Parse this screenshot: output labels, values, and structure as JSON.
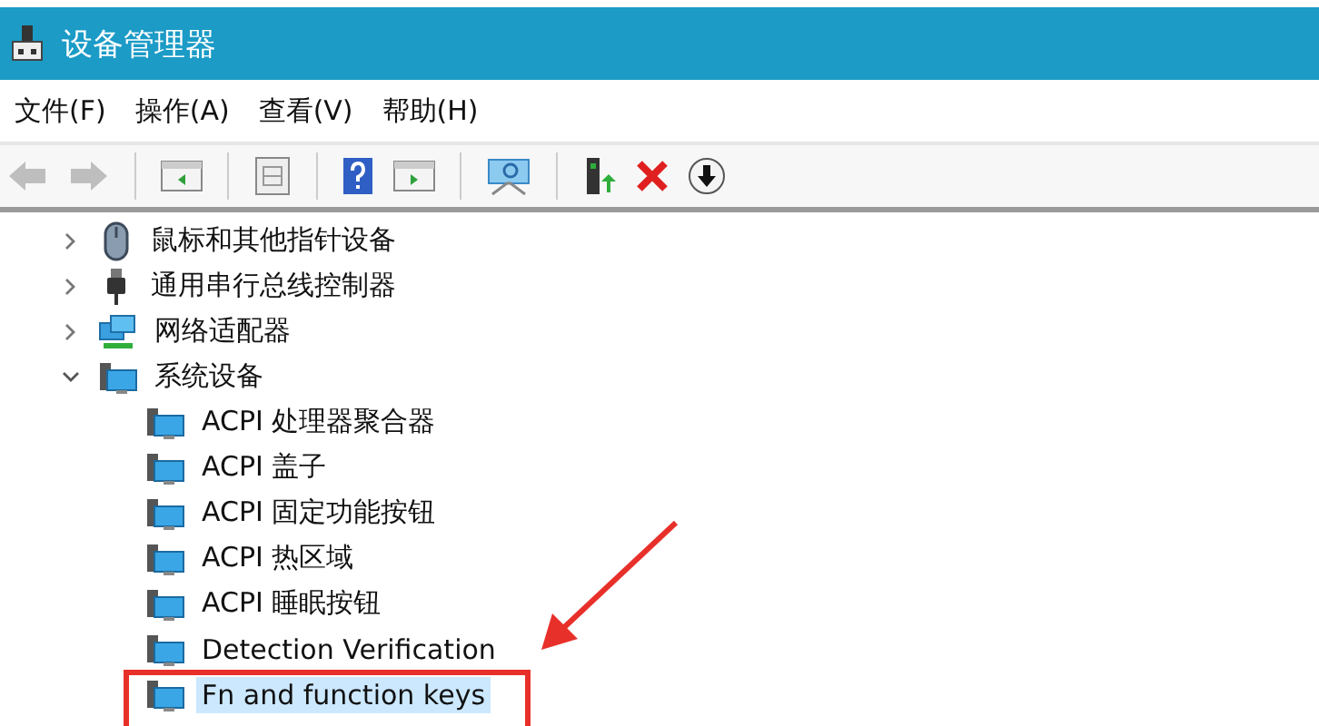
{
  "window": {
    "title": "设备管理器"
  },
  "menu": [
    "文件(F)",
    "操作(A)",
    "查看(V)",
    "帮助(H)"
  ],
  "toolbar": [
    {
      "kind": "back",
      "disabled": true
    },
    {
      "kind": "forward",
      "disabled": true
    },
    {
      "kind": "sep"
    },
    {
      "kind": "panel-left",
      "disabled": false
    },
    {
      "kind": "sep"
    },
    {
      "kind": "properties",
      "disabled": false
    },
    {
      "kind": "sep"
    },
    {
      "kind": "help",
      "disabled": false
    },
    {
      "kind": "panel-right",
      "disabled": false
    },
    {
      "kind": "sep"
    },
    {
      "kind": "monitor",
      "disabled": false
    },
    {
      "kind": "sep"
    },
    {
      "kind": "update",
      "disabled": false
    },
    {
      "kind": "remove",
      "disabled": false
    },
    {
      "kind": "download",
      "disabled": false
    }
  ],
  "tree": [
    {
      "label": "鼠标和其他指针设备",
      "kind": "mouse",
      "expanded": false
    },
    {
      "label": "通用串行总线控制器",
      "kind": "usb",
      "expanded": false
    },
    {
      "label": "网络适配器",
      "kind": "network",
      "expanded": false
    },
    {
      "label": "系统设备",
      "kind": "system",
      "expanded": true,
      "children": [
        {
          "label": "ACPI 处理器聚合器",
          "kind": "system",
          "selected": false
        },
        {
          "label": "ACPI 盖子",
          "kind": "system",
          "selected": false
        },
        {
          "label": "ACPI 固定功能按钮",
          "kind": "system",
          "selected": false
        },
        {
          "label": "ACPI 热区域",
          "kind": "system",
          "selected": false
        },
        {
          "label": "ACPI 睡眠按钮",
          "kind": "system",
          "selected": false
        },
        {
          "label": "Detection Verification",
          "kind": "system",
          "selected": false
        },
        {
          "label": "Fn and function keys",
          "kind": "system",
          "selected": true
        }
      ]
    }
  ]
}
